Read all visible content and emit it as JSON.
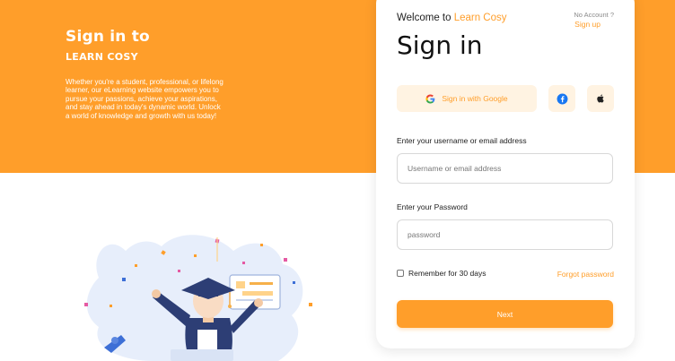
{
  "hero": {
    "title": "Sign in to",
    "subtitle": "LEARN COSY",
    "description": "Whether you're a student, professional, or lifelong learner, our eLearning website empowers you to pursue your passions, achieve your aspirations, and stay ahead in today's dynamic world. Unlock a world of knowledge and growth with us today!"
  },
  "card": {
    "welcome_prefix": "Welcome to ",
    "welcome_brand": "Learn Cosy",
    "no_account": "No Account ?",
    "sign_up": "Sign up",
    "title": "Sign in",
    "google_label": "Sign in with Google"
  },
  "form": {
    "username_label": "Enter your username or email address",
    "username_placeholder": "Username or email address",
    "password_label": "Enter your Password",
    "password_placeholder": "password",
    "remember_label": "Remember for 30 days",
    "forgot_label": "Forgot password",
    "next_label": "Next"
  },
  "icons": {
    "google": "google-icon",
    "facebook": "facebook-icon",
    "apple": "apple-icon"
  },
  "colors": {
    "accent": "#FF9E2A",
    "accent_light": "#FFF3E2",
    "blob": "#E7EEFB"
  }
}
